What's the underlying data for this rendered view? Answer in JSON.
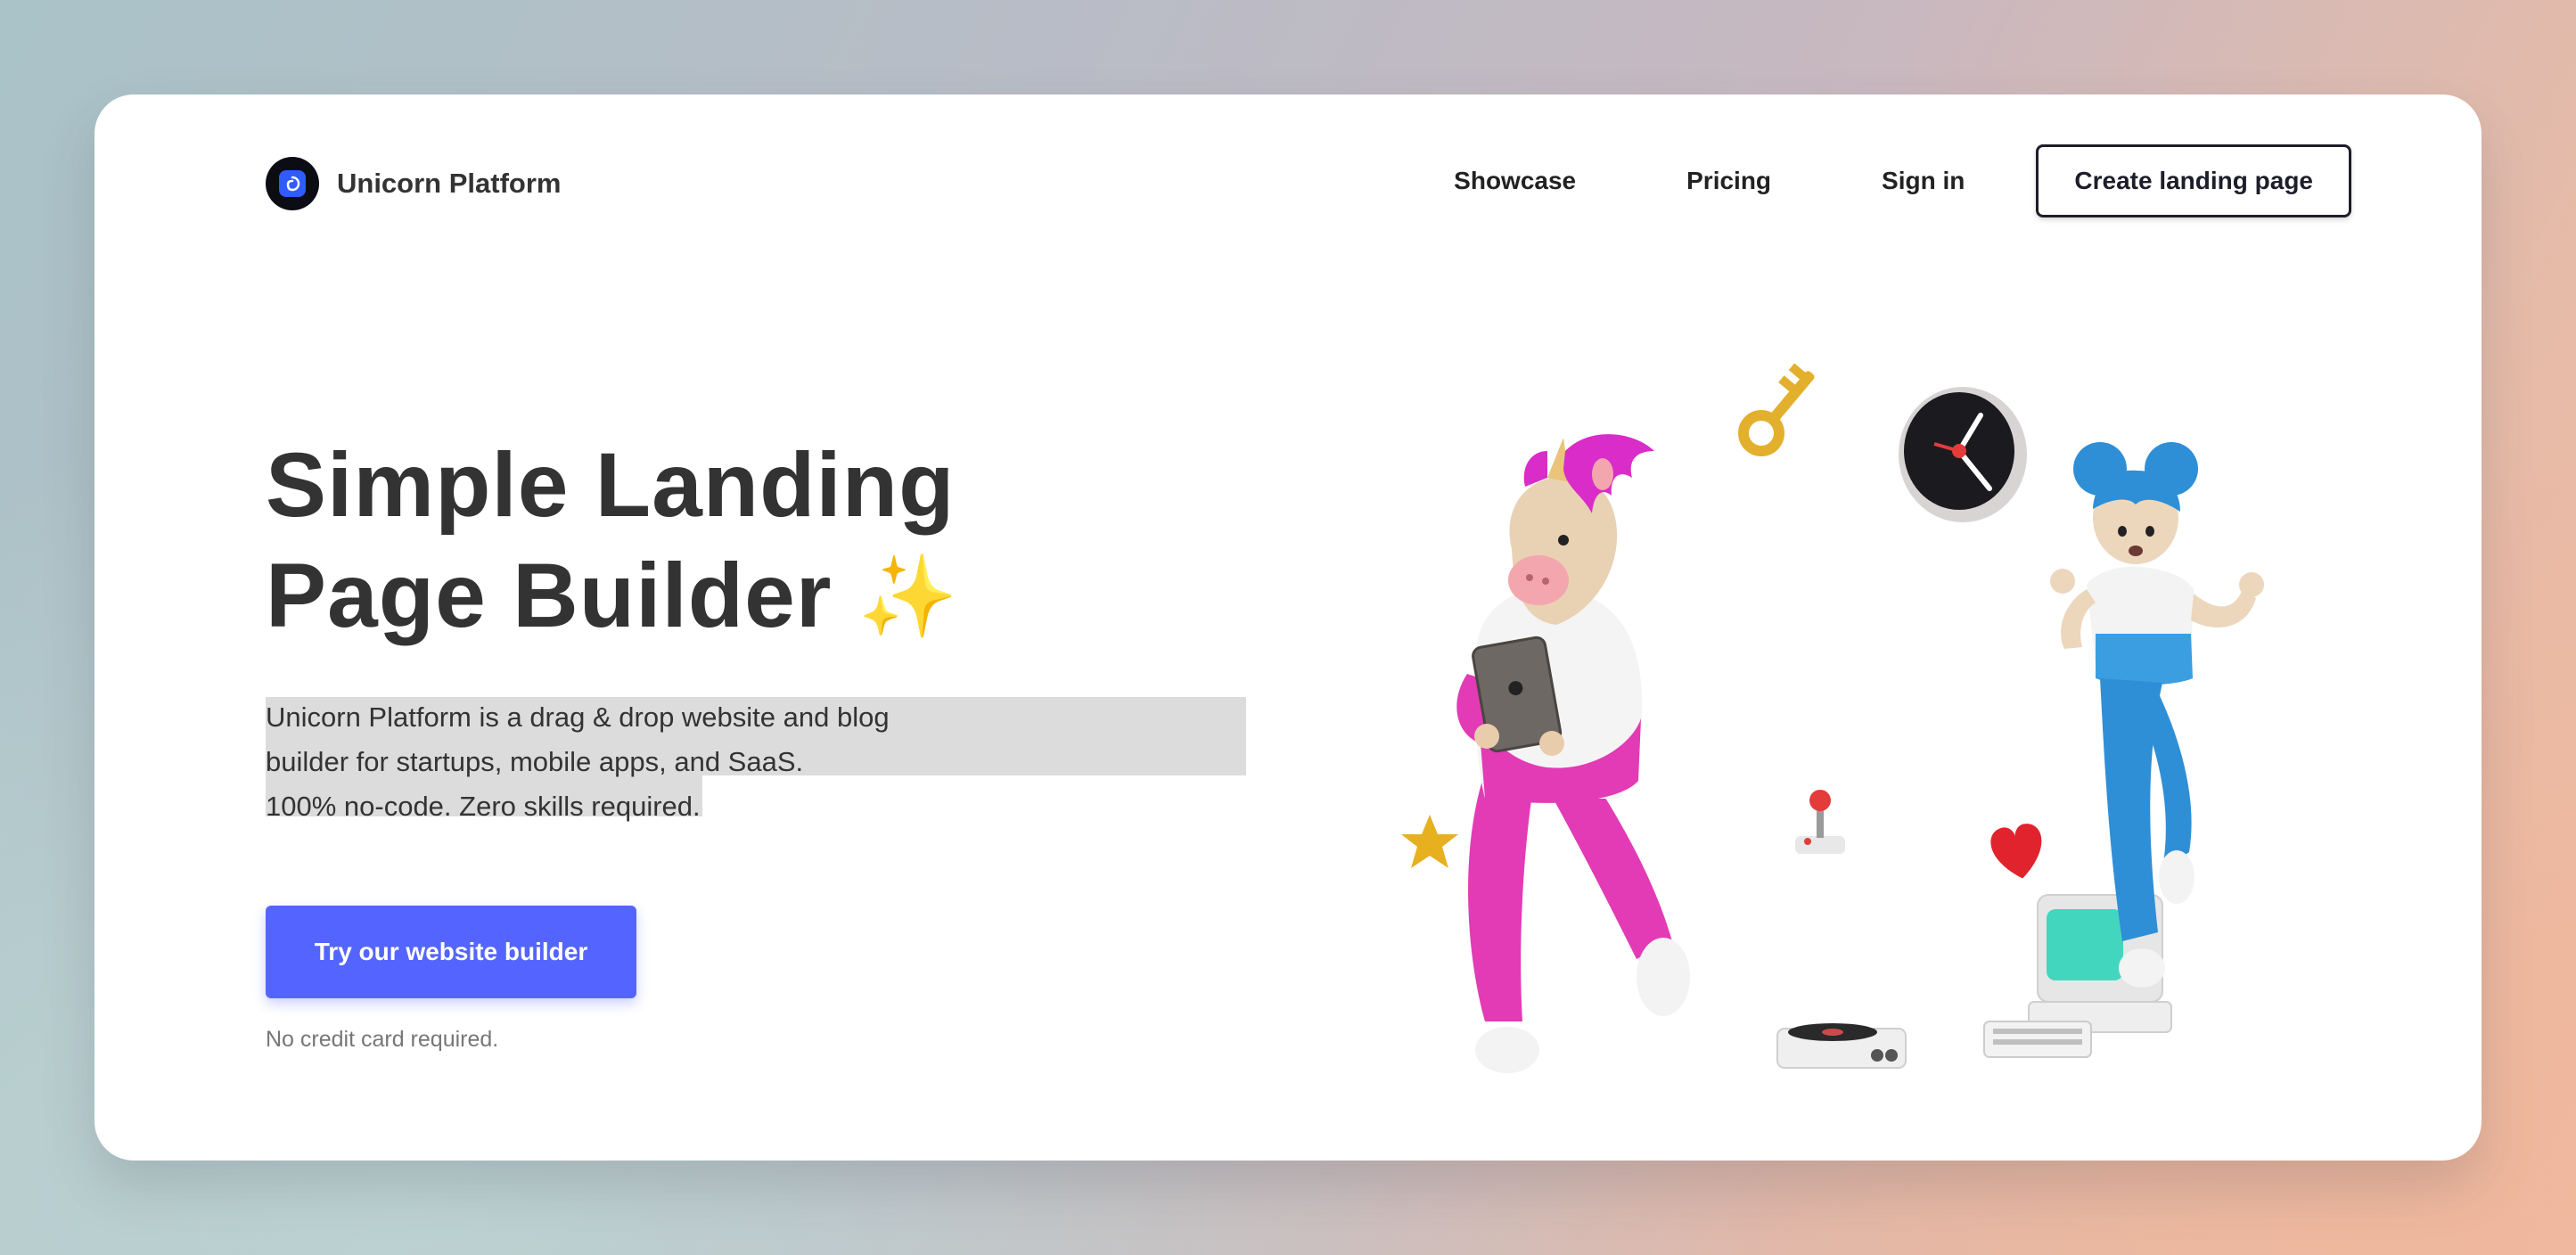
{
  "header": {
    "brand": "Unicorn Platform",
    "nav": [
      {
        "label": "Showcase"
      },
      {
        "label": "Pricing"
      },
      {
        "label": "Sign in"
      }
    ],
    "cta_label": "Create landing page"
  },
  "hero": {
    "headline_line1": "Simple Landing",
    "headline_line2": "Page Builder",
    "sparkle": "✨",
    "description_line1": "Unicorn Platform is a drag & drop website and blog",
    "description_line2": "builder for startups, mobile apps, and SaaS.",
    "description_line3": "100% no-code. Zero skills required.",
    "button_label": "Try our website builder",
    "note": "No credit card required."
  },
  "colors": {
    "primary": "#5465ff",
    "text": "#333333",
    "highlight": "#dcdcdc"
  },
  "illustration": {
    "icons": [
      "unicorn-character",
      "girl-character",
      "key-icon",
      "clock-icon",
      "star-icon",
      "joystick-icon",
      "heart-icon",
      "record-player-icon",
      "retro-computer-icon"
    ]
  }
}
